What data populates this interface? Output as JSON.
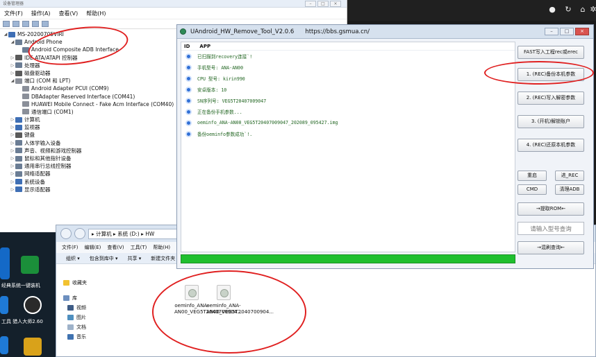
{
  "topbar": {
    "icons": [
      "settings-icon",
      "refresh-icon",
      "home-icon",
      "gear-icon"
    ]
  },
  "device_manager": {
    "title": "设备管理器",
    "menu": [
      "文件(F)",
      "操作(A)",
      "查看(V)",
      "帮助(H)"
    ],
    "tree": [
      {
        "label": "MS-20200705VIRI",
        "indent": 0
      },
      {
        "label": "Android Phone",
        "indent": 1
      },
      {
        "label": "Android Composite ADB Interface",
        "indent": 2
      },
      {
        "label": "IDE ATA/ATAPI 控制器",
        "indent": 1
      },
      {
        "label": "处理器",
        "indent": 1
      },
      {
        "label": "磁盘驱动器",
        "indent": 1
      },
      {
        "label": "端口 (COM 和 LPT)",
        "indent": 1
      },
      {
        "label": "Android Adapter PCUI (COM9)",
        "indent": 2
      },
      {
        "label": "DBAdapter Reserved Interface (COM41)",
        "indent": 2
      },
      {
        "label": "HUAWEI Mobile Connect - Fake Acm Interface (COM40)",
        "indent": 2
      },
      {
        "label": "通信端口 (COM1)",
        "indent": 2
      },
      {
        "label": "计算机",
        "indent": 1
      },
      {
        "label": "监视器",
        "indent": 1
      },
      {
        "label": "键盘",
        "indent": 1
      },
      {
        "label": "人体学输入设备",
        "indent": 1
      },
      {
        "label": "声音、视频和游戏控制器",
        "indent": 1
      },
      {
        "label": "鼠标和其他指针设备",
        "indent": 1
      },
      {
        "label": "通用串行总线控制器",
        "indent": 1
      },
      {
        "label": "网络适配器",
        "indent": 1
      },
      {
        "label": "系统设备",
        "indent": 1
      },
      {
        "label": "显示适配器",
        "indent": 1
      }
    ]
  },
  "tool": {
    "title": "UAndroid_HW_Remove_Tool_V2.0.6",
    "url": "https://bbs.gsmua.cn/",
    "log_columns": [
      "ID",
      "APP"
    ],
    "log": [
      "已扫描到recovery连接`!",
      "手机型号: ANA-AN00",
      "CPU 型号: kirin990",
      "安卓版本: 10",
      "SN序列号: VEG5T20407009047",
      "正在备份手机参数...",
      "oeminfo_ANA-AN00_VEG5T20407009047_202089_095427.img",
      "备份oeminfo参数成功`!."
    ],
    "progress_percent": 100,
    "buttons": {
      "fastboot_rec": "FAST写入工程rec或erec",
      "backup": "1. (REC)备份本机参数",
      "write_unlock": "2. (REC)写入解密参数",
      "unlock_account": "3. (开机)解锁账户",
      "restore": "4. (REC)还原本机参数",
      "reboot": "重启",
      "enter_rec": "进_REC",
      "cmd": "CMD",
      "clear_adb": "清理ADB",
      "extract_rom": "→提取ROM←",
      "model_query_placeholder": "请输入型号查询",
      "mix_query": "→混刷查询←"
    }
  },
  "explorer": {
    "breadcrumb": "▸ 计算机 ▸ 系统 (D:) ▸ HW",
    "menu": [
      "文件(F)",
      "编辑(E)",
      "查看(V)",
      "工具(T)",
      "帮助(H)"
    ],
    "toolbar": [
      "组织 ▾",
      "包含到库中 ▾",
      "共享 ▾",
      "新建文件夹"
    ],
    "sidebar": [
      "收藏夹",
      "库",
      "视频",
      "图片",
      "文档",
      "音乐"
    ],
    "files": [
      "oeminfo_ANA-AN00_VEG5T2040700904...",
      "oeminfo_ANA-AN00_VEG5T2040700904..."
    ]
  },
  "desktop": {
    "labels": [
      "经典系统一键装机",
      "工具",
      "猎人大师2.60"
    ]
  }
}
